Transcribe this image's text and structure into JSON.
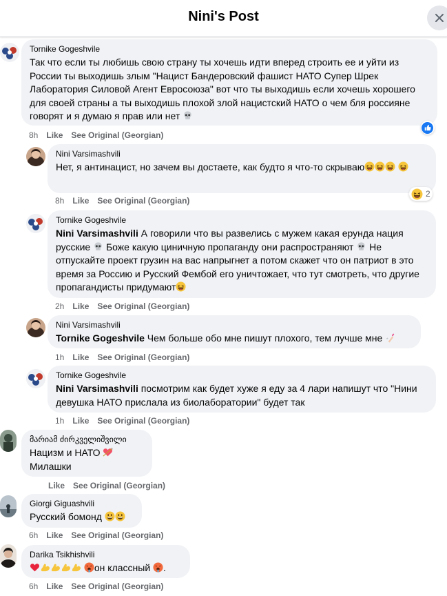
{
  "header": {
    "title": "Nini's Post"
  },
  "comments": [
    {
      "author": "Tornike Gogeshvile",
      "text": "Так что если ты любишь свою страну ты хочешь идти вперед строить ее и уйти из России ты выходишь злым \"Нацист Бандеровский фашист НАТО Супер Шрек Лаборатория Силовой Агент Евросоюза\" вот что ты выходишь если хочешь хорошего для своей страны а ты выходишь плохой злой нацистский НАТО о чем бля россияне говорят и я думаю я прав или нет",
      "time": "8h",
      "like": "Like",
      "see_original": "See Original (Georgian)"
    },
    {
      "author": "Nini Varsimashvili",
      "text": "Нет, я антинацист, но зачем вы достаете, как будто я что-то скрываю",
      "time": "8h",
      "like": "Like",
      "see_original": "See Original (Georgian)",
      "reaction_count": "2"
    },
    {
      "author": "Tornike Gogeshvile",
      "mention": "Nini Varsimashvili",
      "text": "А говорили что вы развелись с мужем какая ерунда нация русские",
      "text2": "Боже какую циничную пропаганду они распространяют",
      "text3": "Не отпускайте проект грузин на вас напрыгнет а потом скажет что он патриот в это время за Россию и Русский Фембой его уничтожает, что тут смотреть, что другие пропагандисты придумают",
      "time": "2h",
      "like": "Like",
      "see_original": "See Original (Georgian)"
    },
    {
      "author": "Nini Varsimashvili",
      "mention": "Tornike Gogeshvile",
      "text": "Чем больше обо мне пишут плохого, тем лучше мне",
      "time": "1h",
      "like": "Like",
      "see_original": "See Original (Georgian)"
    },
    {
      "author": "Tornike Gogeshvile",
      "mention": "Nini Varsimashvili",
      "text": "посмотрим как будет хуже я еду за 4 лари напишут что \"Нини девушка НАТО прислала из биолаборатории\" будет так",
      "time": "1h",
      "like": "Like",
      "see_original": "See Original (Georgian)"
    },
    {
      "author": "მარიამ ძირკველიშვილი",
      "text": "Нацизм и НАТО",
      "text2": "Милашки",
      "like": "Like",
      "see_original": "See Original (Georgian)"
    },
    {
      "author": "Giorgi Giguashvili",
      "text": "Русский бомонд",
      "time": "6h",
      "like": "Like",
      "see_original": "See Original (Georgian)"
    },
    {
      "author": "Darika Tsikhishvili",
      "text": "он классный",
      "time": "6h",
      "like": "Like",
      "see_original": "See Original (Georgian)"
    }
  ],
  "colors": {
    "bubble": "#f0f2f5",
    "meta": "#65676b",
    "like_blue": "#1877f2"
  },
  "icons": [
    "close-icon",
    "skull-emoji",
    "laughing-emoji",
    "nail-polish-emoji",
    "heart-arrow-emoji",
    "grin-emoji",
    "heart-emoji",
    "flexed-biceps-emoji",
    "hot-face-emoji",
    "like-reaction-icon",
    "haha-reaction-icon"
  ]
}
